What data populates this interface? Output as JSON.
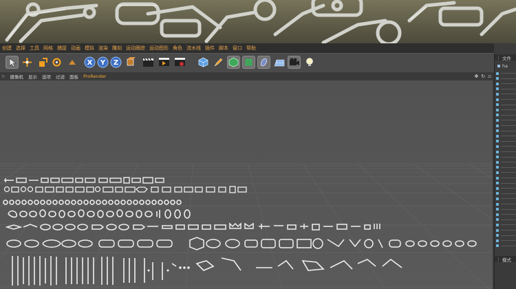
{
  "menubar": {
    "items": [
      "创建",
      "选择",
      "工具",
      "网格",
      "捕捉",
      "动画",
      "模拟",
      "渲染",
      "雕刻",
      "运动跟踪",
      "运动图形",
      "角色",
      "流水线",
      "插件",
      "脚本",
      "窗口",
      "帮助"
    ]
  },
  "viewport_menu": {
    "items": [
      "摄像机",
      "显示",
      "选项",
      "过滤",
      "面板"
    ],
    "prorender": "ProRender"
  },
  "toolbar": {
    "axis_x": "X",
    "axis_y": "Y",
    "axis_z": "Z"
  },
  "right_panel": {
    "top_tab": "文件",
    "second_tab": "ha",
    "bottom_tab": "模式",
    "marker_color": "#6fb7e0"
  },
  "colors": {
    "menu_text": "#e6a24a",
    "accent": "#f0a830",
    "viewport_bg": "#555555"
  }
}
